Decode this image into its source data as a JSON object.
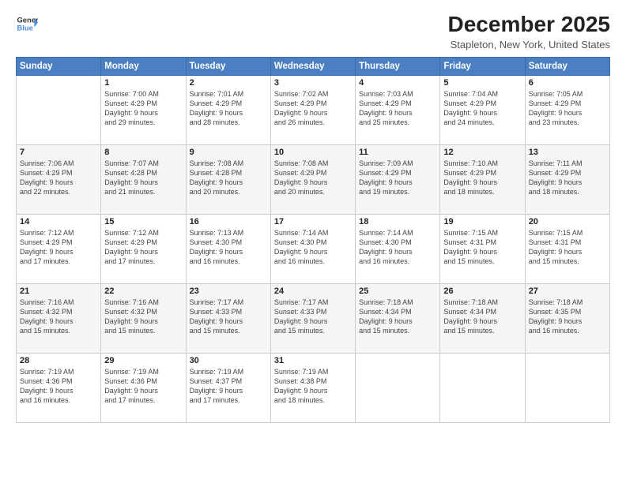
{
  "header": {
    "logo_line1": "General",
    "logo_line2": "Blue",
    "main_title": "December 2025",
    "subtitle": "Stapleton, New York, United States"
  },
  "days_of_week": [
    "Sunday",
    "Monday",
    "Tuesday",
    "Wednesday",
    "Thursday",
    "Friday",
    "Saturday"
  ],
  "weeks": [
    [
      {
        "day": "",
        "info": ""
      },
      {
        "day": "1",
        "info": "Sunrise: 7:00 AM\nSunset: 4:29 PM\nDaylight: 9 hours\nand 29 minutes."
      },
      {
        "day": "2",
        "info": "Sunrise: 7:01 AM\nSunset: 4:29 PM\nDaylight: 9 hours\nand 28 minutes."
      },
      {
        "day": "3",
        "info": "Sunrise: 7:02 AM\nSunset: 4:29 PM\nDaylight: 9 hours\nand 26 minutes."
      },
      {
        "day": "4",
        "info": "Sunrise: 7:03 AM\nSunset: 4:29 PM\nDaylight: 9 hours\nand 25 minutes."
      },
      {
        "day": "5",
        "info": "Sunrise: 7:04 AM\nSunset: 4:29 PM\nDaylight: 9 hours\nand 24 minutes."
      },
      {
        "day": "6",
        "info": "Sunrise: 7:05 AM\nSunset: 4:29 PM\nDaylight: 9 hours\nand 23 minutes."
      }
    ],
    [
      {
        "day": "7",
        "info": "Sunrise: 7:06 AM\nSunset: 4:29 PM\nDaylight: 9 hours\nand 22 minutes."
      },
      {
        "day": "8",
        "info": "Sunrise: 7:07 AM\nSunset: 4:28 PM\nDaylight: 9 hours\nand 21 minutes."
      },
      {
        "day": "9",
        "info": "Sunrise: 7:08 AM\nSunset: 4:28 PM\nDaylight: 9 hours\nand 20 minutes."
      },
      {
        "day": "10",
        "info": "Sunrise: 7:08 AM\nSunset: 4:29 PM\nDaylight: 9 hours\nand 20 minutes."
      },
      {
        "day": "11",
        "info": "Sunrise: 7:09 AM\nSunset: 4:29 PM\nDaylight: 9 hours\nand 19 minutes."
      },
      {
        "day": "12",
        "info": "Sunrise: 7:10 AM\nSunset: 4:29 PM\nDaylight: 9 hours\nand 18 minutes."
      },
      {
        "day": "13",
        "info": "Sunrise: 7:11 AM\nSunset: 4:29 PM\nDaylight: 9 hours\nand 18 minutes."
      }
    ],
    [
      {
        "day": "14",
        "info": "Sunrise: 7:12 AM\nSunset: 4:29 PM\nDaylight: 9 hours\nand 17 minutes."
      },
      {
        "day": "15",
        "info": "Sunrise: 7:12 AM\nSunset: 4:29 PM\nDaylight: 9 hours\nand 17 minutes."
      },
      {
        "day": "16",
        "info": "Sunrise: 7:13 AM\nSunset: 4:30 PM\nDaylight: 9 hours\nand 16 minutes."
      },
      {
        "day": "17",
        "info": "Sunrise: 7:14 AM\nSunset: 4:30 PM\nDaylight: 9 hours\nand 16 minutes."
      },
      {
        "day": "18",
        "info": "Sunrise: 7:14 AM\nSunset: 4:30 PM\nDaylight: 9 hours\nand 16 minutes."
      },
      {
        "day": "19",
        "info": "Sunrise: 7:15 AM\nSunset: 4:31 PM\nDaylight: 9 hours\nand 15 minutes."
      },
      {
        "day": "20",
        "info": "Sunrise: 7:15 AM\nSunset: 4:31 PM\nDaylight: 9 hours\nand 15 minutes."
      }
    ],
    [
      {
        "day": "21",
        "info": "Sunrise: 7:16 AM\nSunset: 4:32 PM\nDaylight: 9 hours\nand 15 minutes."
      },
      {
        "day": "22",
        "info": "Sunrise: 7:16 AM\nSunset: 4:32 PM\nDaylight: 9 hours\nand 15 minutes."
      },
      {
        "day": "23",
        "info": "Sunrise: 7:17 AM\nSunset: 4:33 PM\nDaylight: 9 hours\nand 15 minutes."
      },
      {
        "day": "24",
        "info": "Sunrise: 7:17 AM\nSunset: 4:33 PM\nDaylight: 9 hours\nand 15 minutes."
      },
      {
        "day": "25",
        "info": "Sunrise: 7:18 AM\nSunset: 4:34 PM\nDaylight: 9 hours\nand 15 minutes."
      },
      {
        "day": "26",
        "info": "Sunrise: 7:18 AM\nSunset: 4:34 PM\nDaylight: 9 hours\nand 15 minutes."
      },
      {
        "day": "27",
        "info": "Sunrise: 7:18 AM\nSunset: 4:35 PM\nDaylight: 9 hours\nand 16 minutes."
      }
    ],
    [
      {
        "day": "28",
        "info": "Sunrise: 7:19 AM\nSunset: 4:36 PM\nDaylight: 9 hours\nand 16 minutes."
      },
      {
        "day": "29",
        "info": "Sunrise: 7:19 AM\nSunset: 4:36 PM\nDaylight: 9 hours\nand 17 minutes."
      },
      {
        "day": "30",
        "info": "Sunrise: 7:19 AM\nSunset: 4:37 PM\nDaylight: 9 hours\nand 17 minutes."
      },
      {
        "day": "31",
        "info": "Sunrise: 7:19 AM\nSunset: 4:38 PM\nDaylight: 9 hours\nand 18 minutes."
      },
      {
        "day": "",
        "info": ""
      },
      {
        "day": "",
        "info": ""
      },
      {
        "day": "",
        "info": ""
      }
    ]
  ],
  "accent_color": "#4a7fc1"
}
